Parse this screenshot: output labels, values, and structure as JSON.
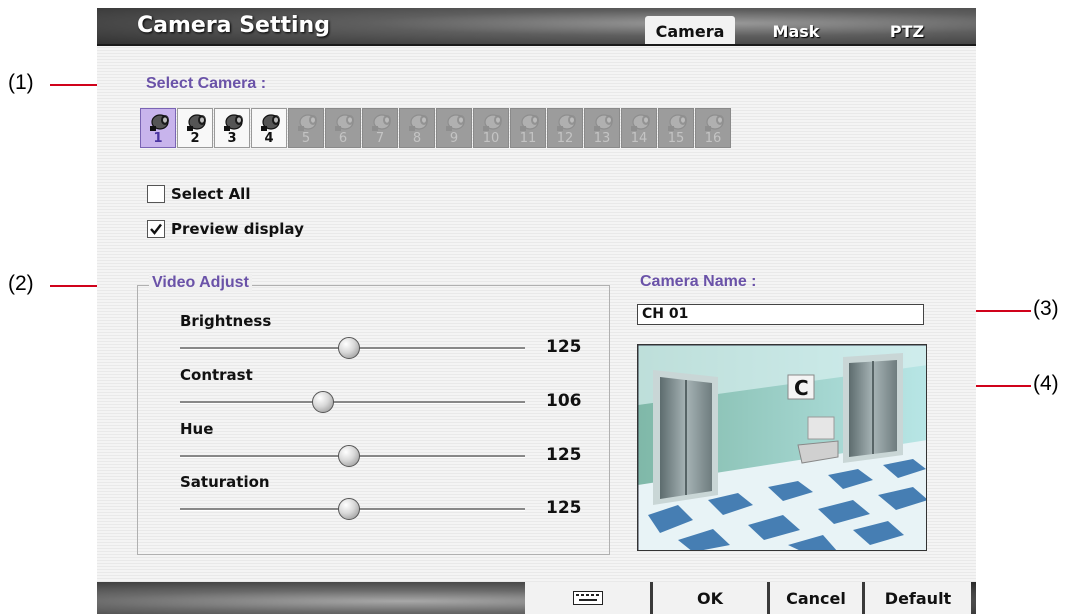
{
  "window": {
    "title": "Camera Setting",
    "tabs": [
      {
        "label": "Camera",
        "active": true
      },
      {
        "label": "Mask",
        "active": false
      },
      {
        "label": "PTZ",
        "active": false
      }
    ]
  },
  "select_camera": {
    "label": "Select Camera :",
    "cameras": [
      {
        "number": "1",
        "state": "selected"
      },
      {
        "number": "2",
        "state": "available"
      },
      {
        "number": "3",
        "state": "available"
      },
      {
        "number": "4",
        "state": "available"
      },
      {
        "number": "5",
        "state": "disabled"
      },
      {
        "number": "6",
        "state": "disabled"
      },
      {
        "number": "7",
        "state": "disabled"
      },
      {
        "number": "8",
        "state": "disabled"
      },
      {
        "number": "9",
        "state": "disabled"
      },
      {
        "number": "10",
        "state": "disabled"
      },
      {
        "number": "11",
        "state": "disabled"
      },
      {
        "number": "12",
        "state": "disabled"
      },
      {
        "number": "13",
        "state": "disabled"
      },
      {
        "number": "14",
        "state": "disabled"
      },
      {
        "number": "15",
        "state": "disabled"
      },
      {
        "number": "16",
        "state": "disabled"
      }
    ],
    "icon": "camera-icon"
  },
  "options": {
    "select_all": {
      "label": "Select All",
      "checked": false
    },
    "preview_display": {
      "label": "Preview display",
      "checked": true
    }
  },
  "video_adjust": {
    "label": "Video Adjust",
    "max": 255,
    "sliders": [
      {
        "label": "Brightness",
        "value": "125"
      },
      {
        "label": "Contrast",
        "value": "106"
      },
      {
        "label": "Hue",
        "value": "125"
      },
      {
        "label": "Saturation",
        "value": "125"
      }
    ]
  },
  "camera_name": {
    "label": "Camera Name :",
    "value": "CH 01"
  },
  "buttons": {
    "keyboard_icon": "keyboard-icon",
    "ok": "OK",
    "cancel": "Cancel",
    "default": "Default"
  },
  "callouts": [
    "(1)",
    "(2)",
    "(3)",
    "(4)"
  ],
  "colors": {
    "accent_label": "#6a52a8",
    "callout_line": "#d0021b",
    "selected_camera": "#c8b4ec"
  }
}
